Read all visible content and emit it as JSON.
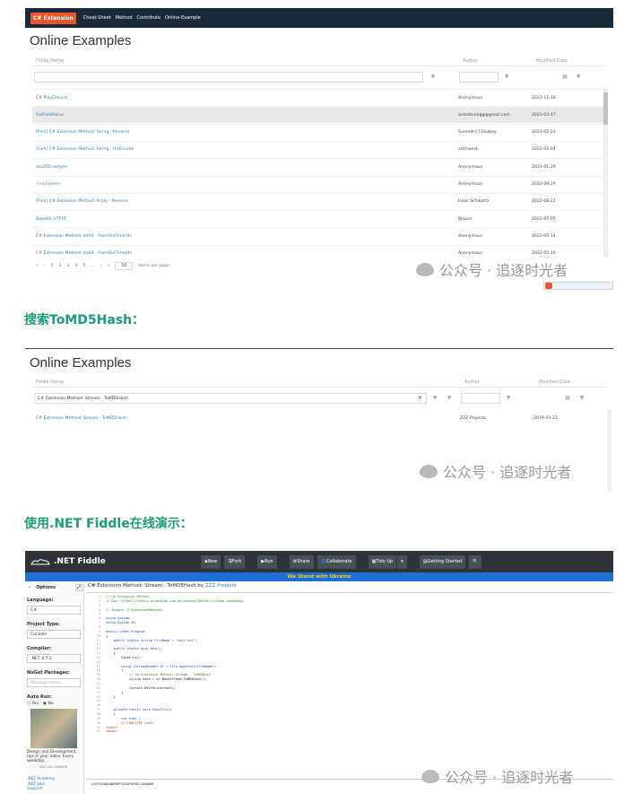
{
  "nav": {
    "brand": "C# Extension",
    "links": [
      "Cheat-Sheet",
      "Method",
      "Contribute",
      "Online-Example"
    ]
  },
  "examples1": {
    "title": "Online Examples",
    "col_name": "Fiddle Name",
    "col_author": "Author",
    "col_date": "Modified Date",
    "rows": [
      {
        "name": "C# PlayGround",
        "author": "Anonymous",
        "date": "2023-11-16"
      },
      {
        "name": "GetFieldValue",
        "author": "anindzcongg@gmail.com",
        "date": "2023-03-17"
      },
      {
        "name": "[Fork] C# Extension Method: String - Reverse",
        "author": "Surendra Choubey",
        "date": "2023-02-23"
      },
      {
        "name": "[Fork] C# Extension Method: String - UrlEncode",
        "author": "xdchwork",
        "date": "2023-02-04"
      },
      {
        "name": "sha256 sample",
        "author": "Anonymous",
        "date": "2023-01-29"
      },
      {
        "name": "<no name>",
        "author": "Anonymous",
        "date": "2022-09-29"
      },
      {
        "name": "[Fork] C# Extension Method: Array - Reverse",
        "author": "Isaac Schwartz",
        "date": "2022-08-21"
      },
      {
        "name": "Base64_UTF16",
        "author": "Brouss",
        "date": "2022-07-05"
      },
      {
        "name": "C# Extension Method: Int64 - FromFileTimeUtc",
        "author": "Anonymous",
        "date": "2022-05-14"
      },
      {
        "name": "C# Extension Method: Int64 - FromFileTimeUtc",
        "author": "Anonymous",
        "date": "2022-05-14"
      }
    ],
    "pager": [
      "«",
      "‹",
      "1",
      "2",
      "3",
      "4",
      "5",
      "...",
      "›",
      "»"
    ],
    "page_size": "50",
    "per_page_label": "items per page"
  },
  "watermark": "公众号 · 追逐时光者",
  "section1": "搜索ToMD5Hash：",
  "examples2": {
    "title": "Online Examples",
    "col_name": "Fiddle Name",
    "col_author": "Author",
    "col_date": "Modified Date",
    "filter_value": "C# Extension Method: Stream - ToMD5Hash",
    "clear": "×",
    "row": {
      "name": "C# Extension Method: Stream - ToMD5Hash",
      "author": "ZZZ Projects",
      "date": "2019-03-23"
    }
  },
  "section2": "使用.NET Fiddle在线演示：",
  "fiddle": {
    "logo": ".NET Fiddle",
    "buttons": [
      "New",
      "Fork",
      "Run",
      "Share",
      "Collaborate",
      "Tidy Up",
      "Getting Started"
    ],
    "banner": "We Stand with Ukraine",
    "doc_title": "C# Extension Method: Stream - ToMD5Hash by",
    "doc_owner": "ZZZ Projects",
    "options": "Options",
    "language_label": "Language:",
    "language": "C#",
    "project_label": "Project Type:",
    "project": "Console",
    "compiler_label": "Compiler:",
    "compiler": ".NET 4.7.2",
    "nuget_label": "NuGet Packages:",
    "nuget_placeholder": "Package name...",
    "autorun_label": "Auto Run:",
    "autorun_yes": "Yes",
    "autorun_no": "No",
    "ad_text": "Design and Development tips in your inbox. Every weekday.",
    "ad_via": "ADS VIA CARBON",
    "links": [
      ".NET Academy",
      ".NET Jobs",
      "Support"
    ],
    "output": "A1EF6250S0BE99PC535F9A3EC1368009",
    "code": [
      {
        "c": "cm",
        "t": "// C# Extension Method"
      },
      {
        "c": "cm",
        "t": "// Doc: https://csharp-extension.com/en/method/1002047/stream-tomd5hash"
      },
      {
        "c": "tx",
        "t": ""
      },
      {
        "c": "cm",
        "t": "// @nuget: Z.ExtensionMethods"
      },
      {
        "c": "tx",
        "t": ""
      },
      {
        "c": "kw",
        "t": "using System;"
      },
      {
        "c": "kw",
        "t": "using System.IO;"
      },
      {
        "c": "tx",
        "t": ""
      },
      {
        "c": "kw",
        "t": "public class Program"
      },
      {
        "c": "tx",
        "t": "{"
      },
      {
        "c": "kw",
        "t": "    public static string FileName = \"test.txt\";"
      },
      {
        "c": "tx",
        "t": ""
      },
      {
        "c": "kw",
        "t": "    public static void Main()"
      },
      {
        "c": "tx",
        "t": "    {"
      },
      {
        "c": "tx",
        "t": "        SaveFile();"
      },
      {
        "c": "tx",
        "t": ""
      },
      {
        "c": "kw",
        "t": "        using (StreamReader sr = File.OpenText(FileName))"
      },
      {
        "c": "tx",
        "t": "        {"
      },
      {
        "c": "cm",
        "t": "            // C# Extension Method: Stream - ToMD5Hash"
      },
      {
        "c": "tx",
        "t": "            string hash = sr.BaseStream.ToMD5Hash();"
      },
      {
        "c": "tx",
        "t": ""
      },
      {
        "c": "tx",
        "t": "            Console.WriteLine(hash);"
      },
      {
        "c": "tx",
        "t": "        }"
      },
      {
        "c": "tx",
        "t": "    }"
      },
      {
        "c": "tx",
        "t": ""
      },
      {
        "c": "tx",
        "t": ""
      },
      {
        "c": "kw",
        "t": "    private static void SaveFile()"
      },
      {
        "c": "tx",
        "t": "    {"
      },
      {
        "c": "kw",
        "t": "        var html ="
      },
      {
        "c": "st",
        "t": "        @\"<!DOCTYPE html>"
      },
      {
        "c": "st",
        "t": "<html>"
      },
      {
        "c": "st",
        "t": "<body>"
      }
    ]
  },
  "colors": {
    "nav": "#1b2a3a",
    "brand": "#e8582a",
    "section": "#1a9c7c",
    "banner": "#1f6fd6",
    "banner_text": "#f4d100",
    "link": "#337ab7"
  }
}
